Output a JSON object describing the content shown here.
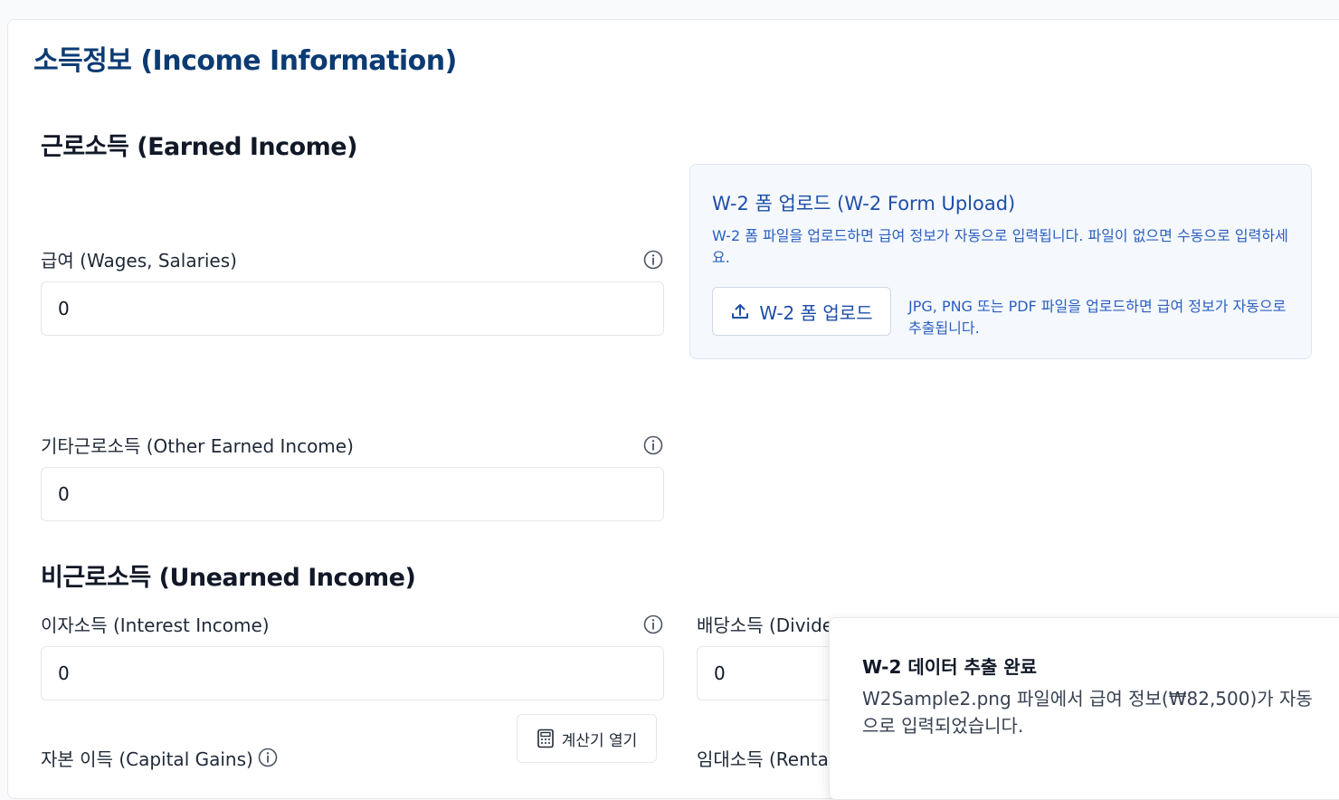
{
  "page": {
    "title": "소득정보 (Income Information)"
  },
  "earned": {
    "section_title": "근로소득 (Earned Income)",
    "wages_label": "급여 (Wages, Salaries)",
    "wages_value": "0",
    "other_label": "기타근로소득 (Other Earned Income)",
    "other_value": "0"
  },
  "w2": {
    "title": "W-2 폼 업로드 (W-2 Form Upload)",
    "description": "W-2 폼 파일을 업로드하면 급여 정보가 자동으로 입력됩니다. 파일이 없으면 수동으로 입력하세요.",
    "button_label": "W-2 폼 업로드",
    "hint": "JPG, PNG 또는 PDF 파일을 업로드하면 급여 정보가 자동으로 추출됩니다."
  },
  "unearned": {
    "section_title": "비근로소득 (Unearned Income)",
    "interest_label": "이자소득 (Interest Income)",
    "interest_value": "0",
    "dividend_label": "배당소득 (Divide",
    "dividend_value": "0",
    "capital_label": "자본 이득 (Capital Gains)",
    "calc_button": "계산기 열기",
    "rental_label": "임대소득 (Renta"
  },
  "toast": {
    "title": "W-2 데이터 추출 완료",
    "message": "W2Sample2.png 파일에서 급여 정보(₩82,500)가 자동으로 입력되었습니다."
  },
  "colors": {
    "title": "#0b3b73",
    "accent": "#1e4fa8",
    "upload_bg": "#f5f8fd"
  },
  "icons": {
    "info": "info-circle-icon",
    "upload": "upload-icon",
    "calculator": "calculator-icon"
  }
}
